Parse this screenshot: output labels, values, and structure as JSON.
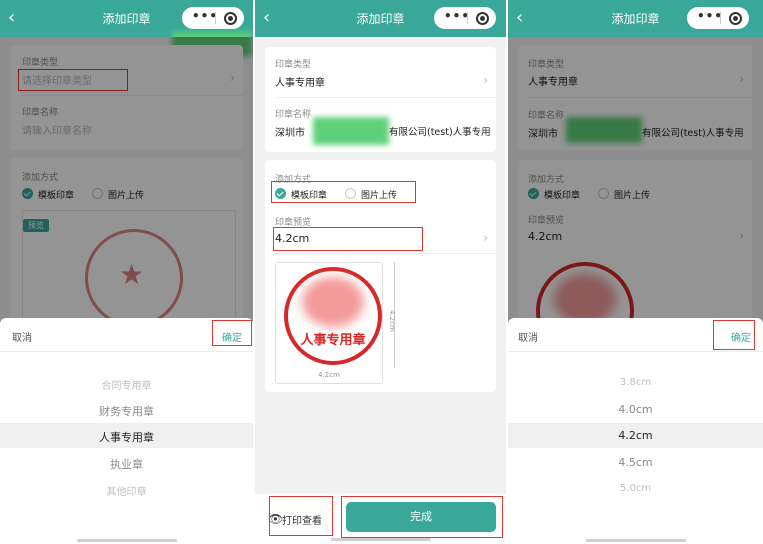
{
  "title": "添加印章",
  "back_icon": "‹",
  "capsule_more": "•••",
  "seal_type_label": "印章类型",
  "seal_type_placeholder": "请选择印章类型",
  "seal_type_value": "人事专用章",
  "seal_name_label": "印章名称",
  "seal_name_placeholder": "请输入印章名称",
  "seal_name_prefix": "深圳市",
  "seal_name_suffix": "有限公司(test)人事专用",
  "add_method_label": "添加方式",
  "method_template": "模板印章",
  "method_upload": "图片上传",
  "preview_label": "印章预览",
  "size_value": "4.2cm",
  "preview_badge": "预览",
  "stamp_text": "人事专用章",
  "dim_width": "4.2cm",
  "dim_height": "4.2cm",
  "cancel_label": "取消",
  "confirm_label": "确定",
  "type_options": [
    "合同专用章",
    "财务专用章",
    "人事专用章",
    "执业章",
    "其他印章"
  ],
  "type_selected_index": 2,
  "size_options": [
    "3.8cm",
    "4.0cm",
    "4.2cm",
    "4.5cm",
    "5.0cm"
  ],
  "size_selected_index": 2,
  "print_view_label": "打印查看",
  "finish_label": "完成",
  "colors": {
    "brand": "#3aa899",
    "highlight": "#e0382f",
    "stamp": "#d62828"
  }
}
